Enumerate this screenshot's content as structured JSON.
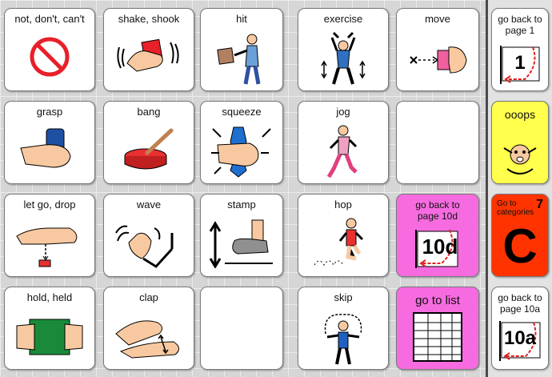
{
  "cells": [
    {
      "id": "not",
      "label": "not, don't, can't"
    },
    {
      "id": "shake",
      "label": "shake,  shook"
    },
    {
      "id": "hit",
      "label": "hit"
    },
    {
      "id": "exercise",
      "label": "exercise"
    },
    {
      "id": "move",
      "label": "move"
    },
    {
      "id": "grasp",
      "label": "grasp"
    },
    {
      "id": "bang",
      "label": "bang"
    },
    {
      "id": "squeeze",
      "label": "squeeze"
    },
    {
      "id": "jog",
      "label": "jog"
    },
    {
      "id": "letgo",
      "label": "let go, drop"
    },
    {
      "id": "wave",
      "label": "wave"
    },
    {
      "id": "stamp",
      "label": "stamp"
    },
    {
      "id": "hop",
      "label": "hop"
    },
    {
      "id": "back10d",
      "label": "go back to page 10d",
      "badge": "10d"
    },
    {
      "id": "hold",
      "label": "hold,  held"
    },
    {
      "id": "clap",
      "label": "clap"
    },
    {
      "id": "skip",
      "label": "skip"
    },
    {
      "id": "golist",
      "label": "go to list"
    }
  ],
  "side": [
    {
      "id": "back1",
      "label": "go back to page 1",
      "badge": "1"
    },
    {
      "id": "ooops",
      "label": "ooops"
    },
    {
      "id": "cats",
      "label": "Go to categories",
      "number": "7",
      "letter": "C"
    },
    {
      "id": "back10a",
      "label": "go back to page 10a",
      "badge": "10a"
    }
  ],
  "colors": {
    "nav_pink": "#f66be0",
    "ooops_yellow": "#ffff4c",
    "categories_orange": "#ff3300",
    "arrow_red": "#e02020"
  }
}
